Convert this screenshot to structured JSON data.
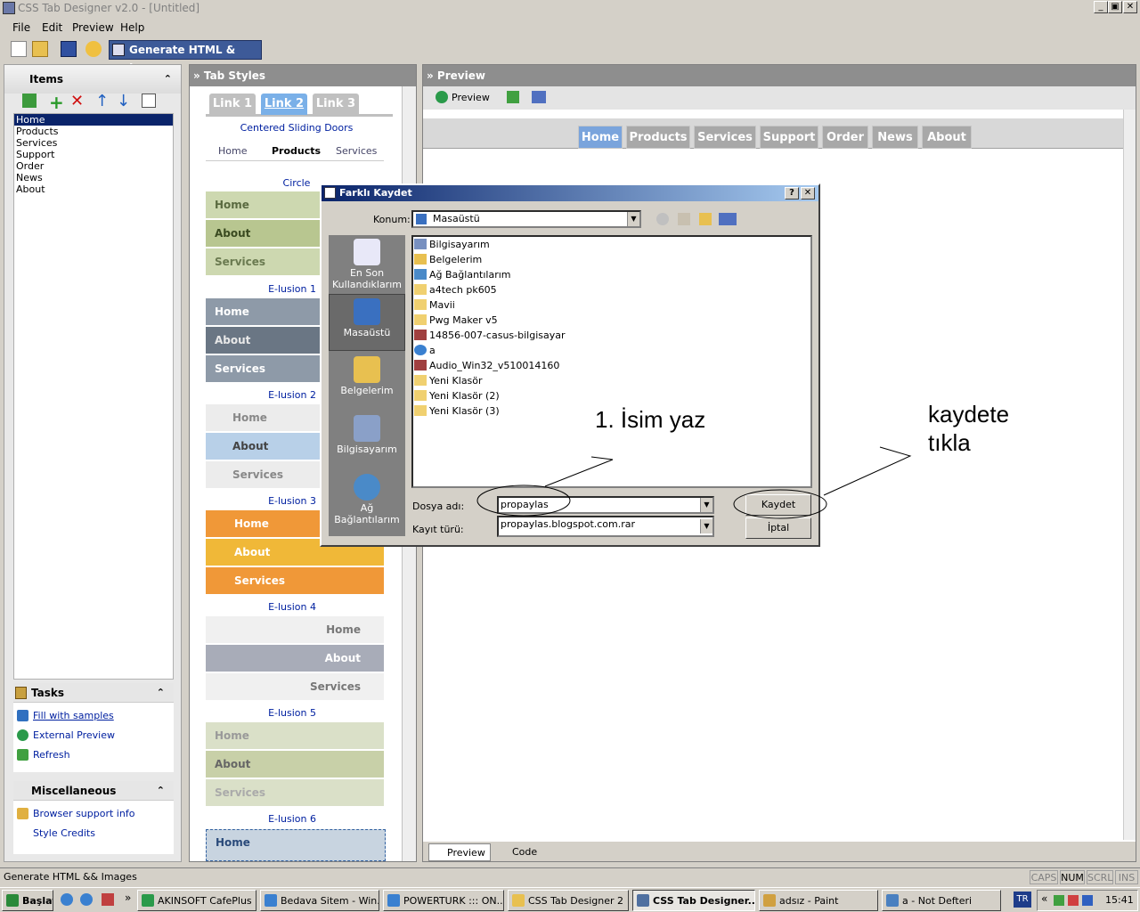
{
  "window": {
    "title": "CSS Tab Designer v2.0 - [Untitled]",
    "min": "_",
    "max": "▣",
    "close": "✕"
  },
  "menu": [
    "File",
    "Edit",
    "Preview",
    "Help"
  ],
  "toolbar": {
    "generate_label": "Generate HTML & Images"
  },
  "items_panel": {
    "title": "Items",
    "items": [
      "Home",
      "Products",
      "Services",
      "Support",
      "Order",
      "News",
      "About"
    ]
  },
  "tasks": {
    "title": "Tasks",
    "links": [
      "Fill with samples",
      "External Preview",
      "Refresh"
    ]
  },
  "misc": {
    "title": "Miscellaneous",
    "links": [
      "Browser support info",
      "Style Credits"
    ]
  },
  "tab_styles": {
    "title": "» Tab Styles",
    "top_tabs": [
      "Link 1",
      "Link 2",
      "Link 3"
    ],
    "centered_label": "Centered Sliding Doors",
    "circle_tabs": [
      "Home",
      "Products",
      "Services"
    ],
    "circle_label": "Circle",
    "stack_items": [
      "Home",
      "About",
      "Services"
    ],
    "labels": [
      "E-lusion 1",
      "E-lusion 2",
      "E-lusion 3",
      "E-lusion 4",
      "E-lusion 5",
      "E-lusion 6"
    ],
    "last_item": "Home"
  },
  "preview": {
    "title": "» Preview",
    "toolbar_label": "Preview",
    "tabs": [
      "Home",
      "Products",
      "Services",
      "Support",
      "Order",
      "News",
      "About"
    ],
    "bottom_tabs": [
      "Preview",
      "Code"
    ]
  },
  "dialog": {
    "title": "Farklı Kaydet",
    "konum_label": "Konum:",
    "konum_value": "Masaüstü",
    "places": [
      "En Son Kullandıklarım",
      "Masaüstü",
      "Belgelerim",
      "Bilgisayarım",
      "Ağ Bağlantılarım"
    ],
    "files": [
      "Bilgisayarım",
      "Belgelerim",
      "Ağ Bağlantılarım",
      "a4tech pk605",
      "Mavii",
      "Pwg Maker v5",
      "14856-007-casus-bilgisayar",
      "a",
      "Audio_Win32_v510014160",
      "Yeni Klasör",
      "Yeni Klasör (2)",
      "Yeni Klasör (3)"
    ],
    "filename_label": "Dosya adı:",
    "filename_value": "propaylas",
    "filetype_label": "Kayıt türü:",
    "filetype_value": "propaylas.blogspot.com.rar",
    "save": "Kaydet",
    "cancel": "İptal"
  },
  "annotations": {
    "step1": "1. İsim yaz",
    "step2_line1": "kaydete",
    "step2_line2": "tıkla"
  },
  "status": {
    "text": "Generate HTML && Images",
    "caps": "CAPS",
    "num": "NUM",
    "scrl": "SCRL",
    "ins": "INS"
  },
  "taskbar": {
    "start": "Başlat",
    "items": [
      "AKINSOFT CafePlus",
      "Bedava Sitem - Win...",
      "POWERTURK ::: ON...",
      "CSS Tab Designer 2",
      "CSS Tab Designer...",
      "adsız - Paint",
      "a - Not Defteri"
    ],
    "lang": "TR",
    "clock": "15:41"
  }
}
